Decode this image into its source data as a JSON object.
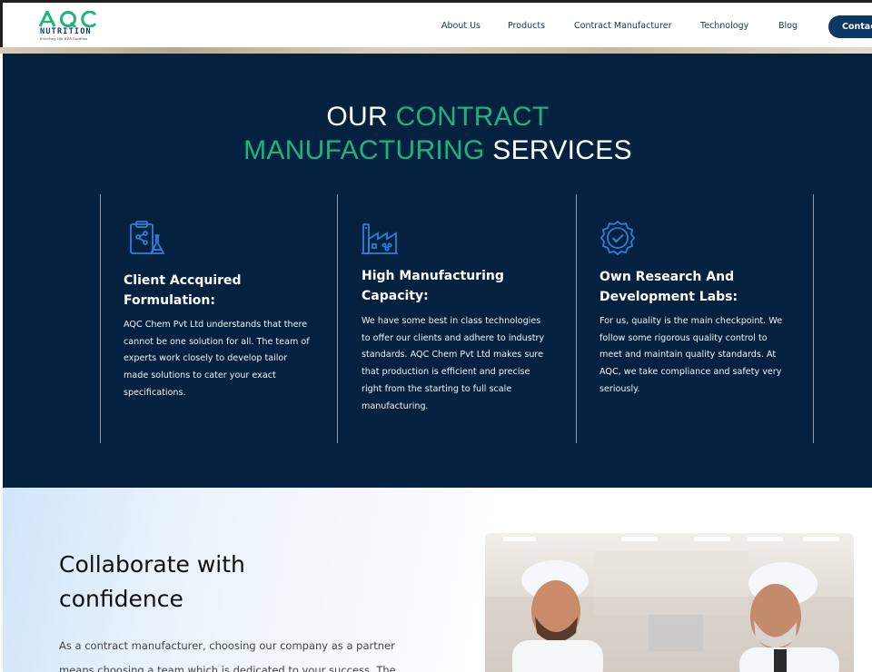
{
  "header": {
    "logo_text": "AQC",
    "logo_word": "NUTRITION",
    "logo_tagline": "Enriching Life With Nutrition",
    "nav": [
      "About Us",
      "Products",
      "Contract Manufacturer",
      "Technology",
      "Blog"
    ],
    "contact_label": "Contact"
  },
  "services": {
    "title_part1": "OUR ",
    "title_part2": "CONTRACT",
    "title_part3": "MANUFACTURING",
    "title_part4": " SERVICES",
    "cards": [
      {
        "icon": "lab-clipboard-icon",
        "title_line1": "Client Accquired",
        "title_line2": "Formulation:",
        "text": [
          "AQC Chem Pvt Ltd understands that there",
          "cannot be one solution for all. The team of",
          "experts work closely to develop tailor",
          "made solutions to cater your exact",
          "specifications."
        ]
      },
      {
        "icon": "factory-icon",
        "title_line1": "High Manufacturing",
        "title_line2": "Capacity:",
        "text": [
          "We have some best in class technologies",
          "to offer our clients and adhere to industry",
          "standards. AQC Chem Pvt Ltd makes sure",
          "that production is efficient and precise",
          "right from the starting to full scale",
          "manufacturing."
        ]
      },
      {
        "icon": "quality-badge-icon",
        "title_line1": "Own Research And",
        "title_line2": "Development Labs:",
        "text": [
          "For us, quality is the main checkpoint. We",
          "follow some rigorous quality control to",
          "meet and maintain quality standards. At",
          "AQC, we take compliance and safety very",
          "seriously."
        ]
      }
    ]
  },
  "collab": {
    "title_line1": "Collaborate with",
    "title_line2": "confidence",
    "text_line1": "As a contract manufacturer, choosing our company as a partner",
    "text_line2": "means choosing a team which is dedicated to your success. The"
  },
  "colors": {
    "navy": "#04223f",
    "accent_green": "#1db37c",
    "icon_blue": "#2f7fd8",
    "button_navy": "#0c3866"
  }
}
